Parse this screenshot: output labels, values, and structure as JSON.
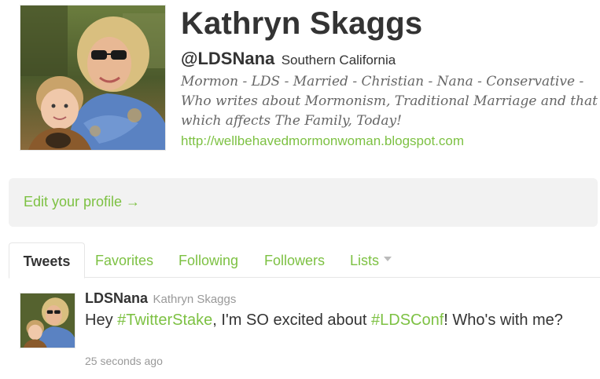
{
  "profile": {
    "name": "Kathryn Skaggs",
    "handle": "@LDSNana",
    "location": "Southern California",
    "bio": "Mormon - LDS - Married - Christian - Nana - Conservative - Who writes about Mormonism, Traditional Marriage and that which affects The Family, Today!",
    "url": "http://wellbehavedmormonwoman.blogspot.com"
  },
  "edit_profile": {
    "label": "Edit your profile →"
  },
  "tabs": {
    "tweets": "Tweets",
    "favorites": "Favorites",
    "following": "Following",
    "followers": "Followers",
    "lists": "Lists"
  },
  "tweet": {
    "username": "LDSNana",
    "fullname": "Kathryn Skaggs",
    "text_1": "Hey ",
    "hashtag_1": "#TwitterStake",
    "text_2": ", I'm SO excited about ",
    "hashtag_2": "#LDSConf",
    "text_3": "! Who's with me?",
    "timestamp": "25 seconds ago"
  },
  "colors": {
    "link": "#7dc143",
    "text": "#333333",
    "muted": "#999999",
    "panel": "#f2f2f2"
  }
}
